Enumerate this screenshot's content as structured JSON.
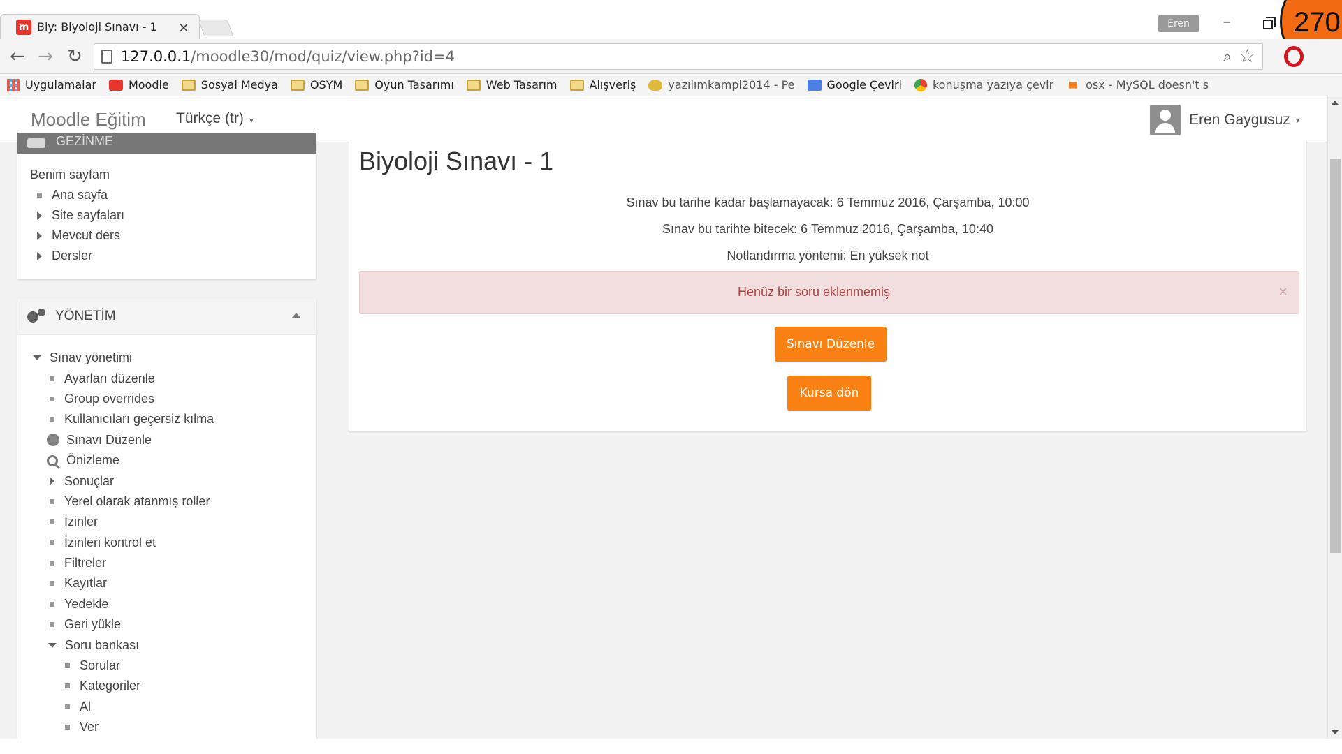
{
  "browser": {
    "tab_title": "Biy: Biyoloji Sınavı - 1",
    "tab_close": "×",
    "tab_favicon": "m",
    "profile_name": "Eren",
    "minimize_glyph": "–",
    "counter_badge": "270",
    "url_host": "127.0.0.1",
    "url_path": "/moodle30/mod/quiz/view.php?id=4",
    "bookmarks": [
      {
        "label": "Uygulamalar",
        "icon": "apps-grid-icon"
      },
      {
        "label": "Moodle",
        "icon": "moodle-icon"
      },
      {
        "label": "Sosyal Medya",
        "icon": "folder-icon"
      },
      {
        "label": "OSYM",
        "icon": "folder-icon"
      },
      {
        "label": "Oyun Tasarımı",
        "icon": "folder-icon"
      },
      {
        "label": "Web Tasarım",
        "icon": "folder-icon"
      },
      {
        "label": "Alışveriş",
        "icon": "folder-icon"
      },
      {
        "label": "yazılımkampi2014 - Pe",
        "icon": "owl-icon"
      },
      {
        "label": "Google Çeviri",
        "icon": "translate-icon"
      },
      {
        "label": "konuşma yazıya çevir",
        "icon": "chrome-icon"
      },
      {
        "label": "osx - MySQL doesn't s",
        "icon": "stackoverflow-icon"
      }
    ]
  },
  "navbar": {
    "brand": "Moodle Eğitim",
    "language": "Türkçe (tr)",
    "user_name": "Eren Gaygusuz",
    "caret": "▾"
  },
  "nav_block": {
    "title": "GEZİNME",
    "items": [
      {
        "label": "Benim sayfam",
        "marker": "none"
      },
      {
        "label": "Ana sayfa",
        "marker": "bullet"
      },
      {
        "label": "Site sayfaları",
        "marker": "arrow"
      },
      {
        "label": "Mevcut ders",
        "marker": "arrow"
      },
      {
        "label": "Dersler",
        "marker": "arrow"
      }
    ]
  },
  "admin_block": {
    "title": "YÖNETİM",
    "items": [
      {
        "label": "Sınav yönetimi",
        "marker": "open",
        "level": 1
      },
      {
        "label": "Ayarları düzenle",
        "marker": "bullet",
        "level": 2
      },
      {
        "label": "Group overrides",
        "marker": "bullet",
        "level": 2
      },
      {
        "label": "Kullanıcıları geçersiz kılma",
        "marker": "bullet",
        "level": 2
      },
      {
        "label": "Sınavı Düzenle",
        "marker": "gear",
        "level": 2
      },
      {
        "label": "Önizleme",
        "marker": "magnifier",
        "level": 2
      },
      {
        "label": "Sonuçlar",
        "marker": "arrow",
        "level": 2
      },
      {
        "label": "Yerel olarak atanmış roller",
        "marker": "bullet",
        "level": 2
      },
      {
        "label": "İzinler",
        "marker": "bullet",
        "level": 2
      },
      {
        "label": "İzinleri kontrol et",
        "marker": "bullet",
        "level": 2
      },
      {
        "label": "Filtreler",
        "marker": "bullet",
        "level": 2
      },
      {
        "label": "Kayıtlar",
        "marker": "bullet",
        "level": 2
      },
      {
        "label": "Yedekle",
        "marker": "bullet",
        "level": 2
      },
      {
        "label": "Geri yükle",
        "marker": "bullet",
        "level": 2
      },
      {
        "label": "Soru bankası",
        "marker": "open",
        "level": 2
      },
      {
        "label": "Sorular",
        "marker": "bullet",
        "level": 3
      },
      {
        "label": "Kategoriler",
        "marker": "bullet",
        "level": 3
      },
      {
        "label": "Al",
        "marker": "bullet",
        "level": 3
      },
      {
        "label": "Ver",
        "marker": "bullet",
        "level": 3
      }
    ]
  },
  "main": {
    "title": "Biyoloji Sınavı - 1",
    "open_info": "Sınav bu tarihe kadar başlamayacak: 6 Temmuz 2016, Çarşamba, 10:00",
    "close_info": "Sınav bu tarihte bitecek: 6 Temmuz 2016, Çarşamba, 10:40",
    "grading_info": "Notlandırma yöntemi: En yüksek not",
    "alert_text": "Henüz bir soru eklenmemiş",
    "alert_close": "×",
    "edit_button": "Sınavı Düzenle",
    "back_button": "Kursa dön"
  },
  "colors": {
    "accent_orange": "#f98012",
    "alert_bg": "#f2dede",
    "alert_text": "#a94442",
    "moodle_red": "#e8352b"
  }
}
